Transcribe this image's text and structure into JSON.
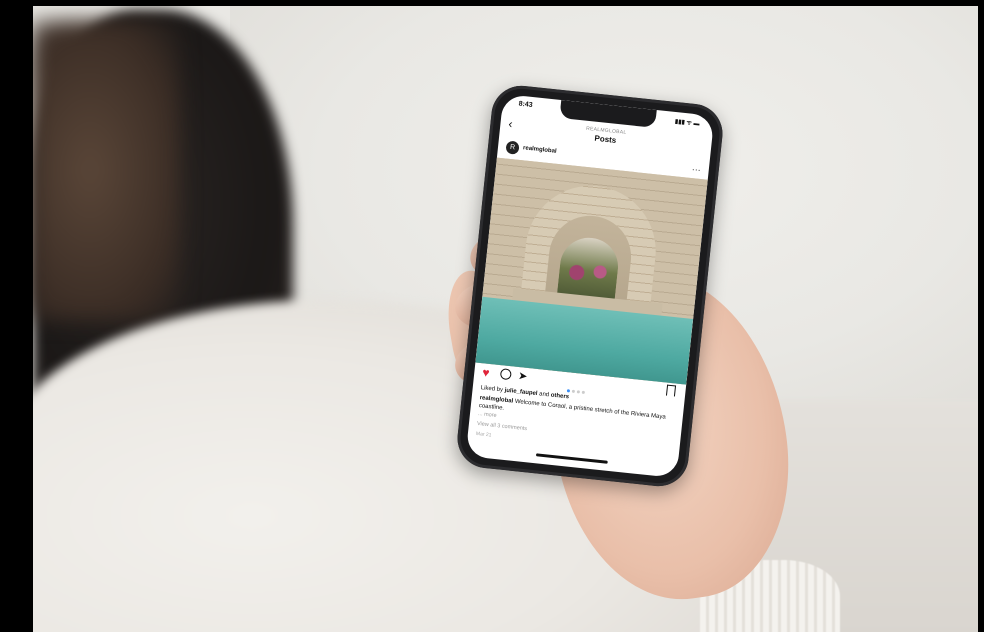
{
  "phone": {
    "status": {
      "time": "8:43",
      "icons": "▮▮▮ ᯤ ▬"
    },
    "header": {
      "subtitle": "REALMGLOBAL",
      "title": "Posts",
      "back_glyph": "‹"
    },
    "post": {
      "avatar_letter": "R",
      "username": "realmglobal",
      "more_glyph": "···",
      "carousel": {
        "count": 4,
        "active_index": 0
      },
      "liked_prefix": "Liked by ",
      "liked_user": "julie_faupel",
      "liked_mid": " and ",
      "liked_others": "others",
      "caption_user": "realmglobal",
      "caption_text": " Welcome to Coraol, a pristine stretch of the Riviera Maya coastline.",
      "more": "... more",
      "view_comments": "View all 3 comments",
      "date": "Mar 21"
    },
    "icons": {
      "heart": "♥",
      "share": "➤",
      "heart_color": "#e0243a",
      "carousel_active_color": "#3a8ef6"
    }
  }
}
